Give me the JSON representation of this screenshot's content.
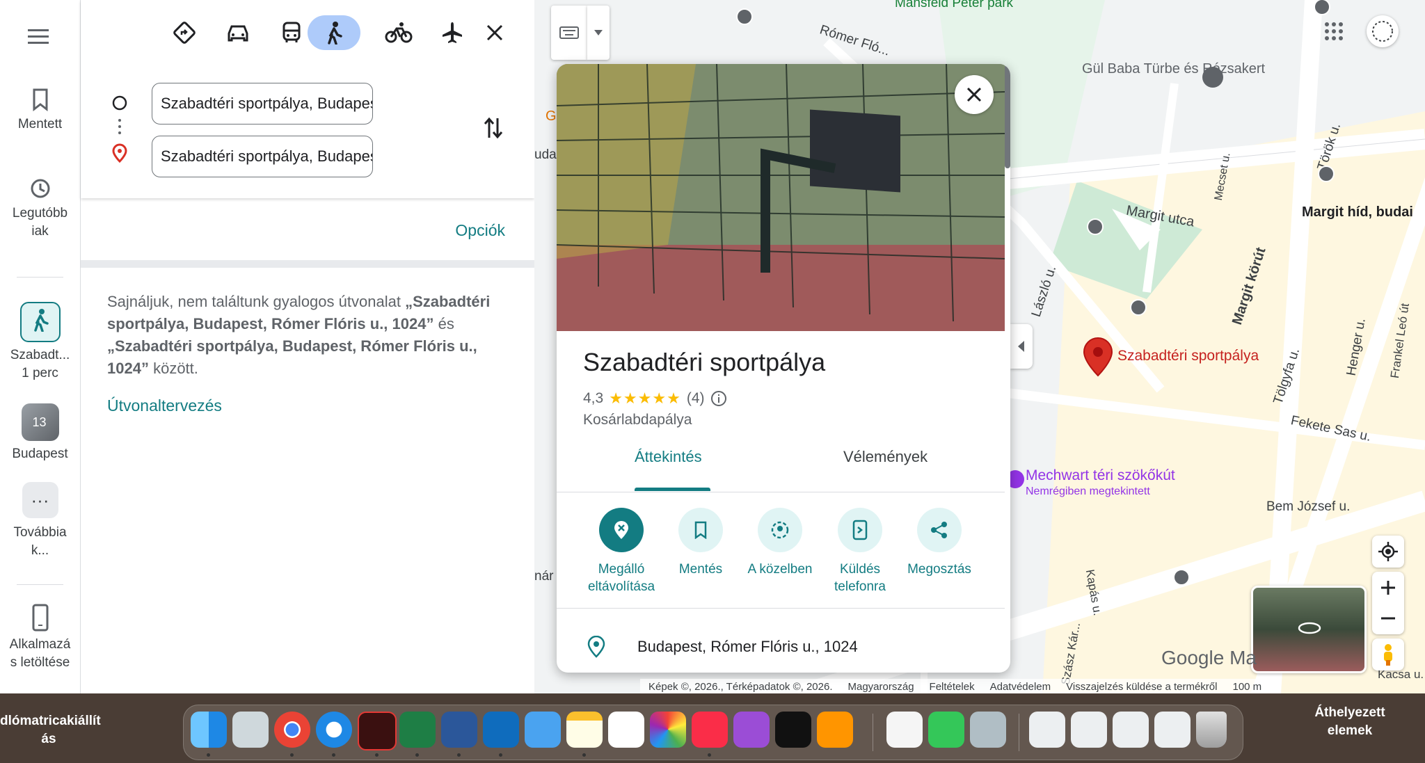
{
  "rail": {
    "saved": "Mentett",
    "recent": "Legutóbb iak",
    "trip_label": "Szabadt...",
    "trip_time": "1 perc",
    "budapest_badge": "13",
    "budapest": "Budapest",
    "more": "Továbbia k...",
    "download": "Alkalmazá s letöltése"
  },
  "directions": {
    "origin": "Szabadtéri sportpálya, Budapest, Rómer",
    "destination": "Szabadtéri sportpálya, Budapest, Rómer",
    "options": "Opciók",
    "message_prefix": "Sajnáljuk, nem találtunk gyalogos útvonalat",
    "message_bold_1": "„Szabadtéri sportpálya, Budapest, Rómer Flóris u., 1024”",
    "message_mid": "és",
    "message_bold_2": "„Szabadtéri sportpálya, Budapest, Rómer Flóris u., 1024”",
    "message_suffix": "között.",
    "route_planning": "Útvonaltervezés"
  },
  "place": {
    "title": "Szabadtéri sportpálya",
    "rating": "4,3",
    "stars": "★★★★★",
    "reviews": "(4)",
    "category": "Kosárlabdapálya",
    "tab_overview": "Áttekintés",
    "tab_reviews": "Vélemények",
    "actions": {
      "remove_stop": "Megálló eltávolítása",
      "save": "Mentés",
      "nearby": "A közelben",
      "send": "Küldés telefonra",
      "share": "Megosztás"
    },
    "address": "Budapest, Rómer Flóris u., 1024"
  },
  "map": {
    "labels": {
      "park": "Mansfeld Péter park",
      "romer": "Rómer Fló...",
      "gul_baba": "Gül Baba Türbe és Rózsakert",
      "margit_utca": "Margit utca",
      "margit_hid": "Margit híd, budai",
      "margit_korut": "Margit körút",
      "torok": "Török u.",
      "mecset": "Mecset u.",
      "laszlo": "László u.",
      "tolgyfa": "Tölgyfa u.",
      "henger": "Henger u.",
      "frankel": "Frankel Leó út",
      "fekete_sas": "Fekete Sas u.",
      "bem": "Bem József u.",
      "kapas": "Kapás u.",
      "szasz": "Szász Kár...",
      "kacsa": "Kacsa u.",
      "place_pin": "Szabadtéri sportpálya",
      "mechwart": "Mechwart téri szökőkút",
      "mechwart_sub": "Nemrégiben megtekintett",
      "edge_g": "G",
      "edge_uda": "uda",
      "edge_nar": "nár",
      "google": "Google Ma"
    },
    "footer": {
      "images": "Képek ©, 2026., Térképadatok ©, 2026.",
      "country": "Magyarország",
      "terms": "Feltételek",
      "privacy": "Adatvédelem",
      "feedback": "Visszajelzés küldése a termékről",
      "scale": "100 m"
    }
  },
  "dock": {
    "left_text": "dlómatricakiállít ás",
    "right_text": "Áthelyezett elemek"
  },
  "colors": {
    "accent": "#137c82",
    "active_mode": "#aecbfa",
    "pin": "#d93025"
  }
}
